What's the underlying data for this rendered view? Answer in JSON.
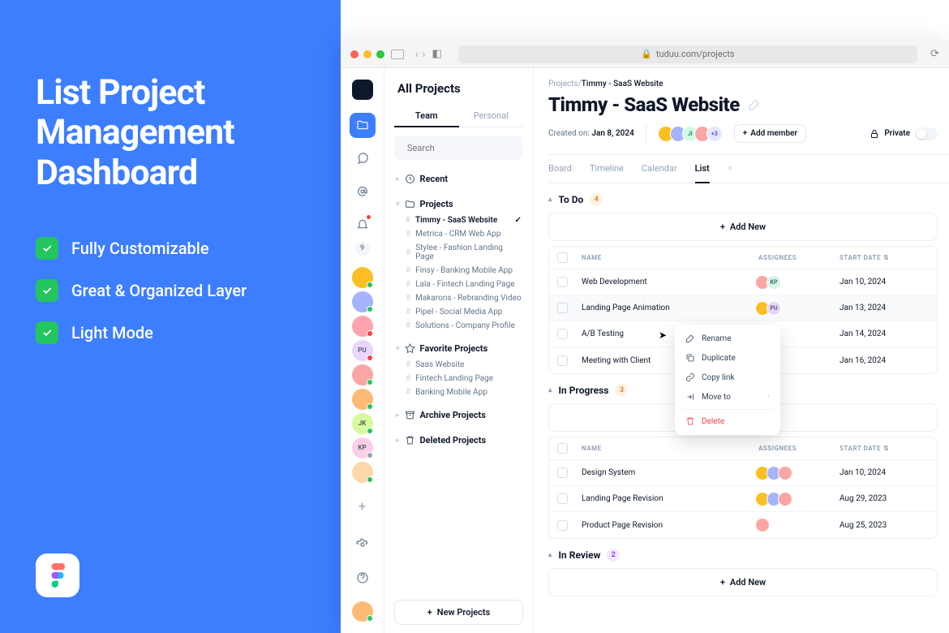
{
  "marketing": {
    "headline": "List Project Management Dashboard",
    "features": [
      "Fully Customizable",
      "Great & Organized Layer",
      "Light Mode"
    ]
  },
  "browser": {
    "url": "tuduu.com/projects"
  },
  "rail": {
    "badge_count": "9",
    "members": [
      {
        "bg": "#fbbf24",
        "dot": "#22c55e"
      },
      {
        "bg": "#a5b4fc",
        "dot": "#22c55e"
      },
      {
        "bg": "#fda4af",
        "dot": "#ef4444"
      },
      {
        "bg": "#e9d5ff",
        "dot": "#ef4444",
        "label": "PU"
      },
      {
        "bg": "#fca5a5",
        "dot": "#22c55e"
      },
      {
        "bg": "#fdba74",
        "dot": "#22c55e"
      },
      {
        "bg": "#d9f99d",
        "dot": "#22c55e",
        "label": "JK"
      },
      {
        "bg": "#fbcfe8",
        "dot": "#94a3b8",
        "label": "KP"
      },
      {
        "bg": "#fed7aa",
        "dot": "#22c55e"
      }
    ]
  },
  "sidebar": {
    "title": "All Projects",
    "tabs": {
      "team": "Team",
      "personal": "Personal"
    },
    "search_placeholder": "Search",
    "recent": "Recent",
    "projects_label": "Projects",
    "projects": [
      {
        "name": "Timmy - SaaS Website",
        "selected": true
      },
      {
        "name": "Metrica - CRM Web App"
      },
      {
        "name": "Stylee - Fashion Landing Page"
      },
      {
        "name": "Finsy - Banking Mobile App"
      },
      {
        "name": "Lala - Fintech Landing Page"
      },
      {
        "name": "Makarons - Rebranding Video"
      },
      {
        "name": "Pipel - Social Media App"
      },
      {
        "name": "Solutions - Company Profile"
      }
    ],
    "favorites_label": "Favorite Projects",
    "favorites": [
      "Saas Website",
      "Fintech Landing Page",
      "Banking Mobile App"
    ],
    "archive": "Archive Projects",
    "deleted": "Deleted Projects",
    "new_project": "New Projects"
  },
  "main": {
    "breadcrumb_root": "Projects/",
    "breadcrumb_current": "Timmy - SaaS Website",
    "title": "Timmy - SaaS Website",
    "created_label": "Created on:",
    "created_value": "Jan 8, 2024",
    "members_extra": "+3",
    "add_member": "Add member",
    "private": "Private",
    "views": {
      "board": "Board",
      "timeline": "Timeline",
      "calendar": "Calendar",
      "list": "List"
    },
    "columns": {
      "name": "NAME",
      "assignees": "ASSIGNEES",
      "start": "START DATE"
    },
    "add_new": "Add New",
    "sections": [
      {
        "label": "To Do",
        "count": "4",
        "badge": "orange",
        "rows": [
          {
            "name": "Web Development",
            "date": "Jan 10, 2024",
            "asg": [
              {
                "bg": "#fca5a5"
              },
              {
                "bg": "#d1fae5",
                "label": "KP"
              }
            ]
          },
          {
            "name": "Landing Page Animation",
            "date": "Jan 13, 2024",
            "hl": true,
            "asg": [
              {
                "bg": "#fbbf24"
              },
              {
                "bg": "#e9d5ff",
                "label": "PU"
              }
            ]
          },
          {
            "name": "A/B Testing",
            "date": "Jan 14, 2024",
            "asg": [
              {
                "bg": "#fca5a5"
              }
            ]
          },
          {
            "name": "Meeting with Client",
            "date": "Jan 16, 2024",
            "asg": [
              {
                "bg": "#fbbf24"
              }
            ]
          }
        ]
      },
      {
        "label": "In Progress",
        "count": "3",
        "badge": "orange",
        "rows": [
          {
            "name": "Design System",
            "date": "Jan 10, 2024",
            "asg": [
              {
                "bg": "#fbbf24"
              },
              {
                "bg": "#a5b4fc"
              },
              {
                "bg": "#fca5a5"
              }
            ]
          },
          {
            "name": "Landing Page Revision",
            "date": "Aug 29, 2023",
            "asg": [
              {
                "bg": "#fbbf24"
              },
              {
                "bg": "#a5b4fc"
              },
              {
                "bg": "#fca5a5"
              }
            ]
          },
          {
            "name": "Product Page Revision",
            "date": "Aug 25, 2023",
            "asg": [
              {
                "bg": "#fca5a5"
              }
            ]
          }
        ]
      },
      {
        "label": "In Review",
        "count": "2",
        "badge": "pur",
        "rows": []
      }
    ]
  },
  "ctx": {
    "rename": "Rename",
    "duplicate": "Duplicate",
    "copylink": "Copy link",
    "moveto": "Move to",
    "delete": "Delete"
  }
}
